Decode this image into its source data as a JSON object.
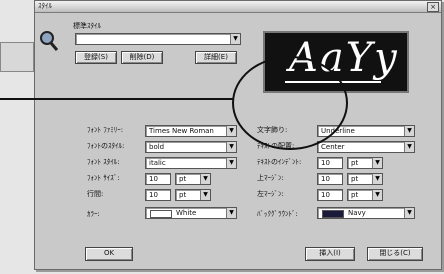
{
  "window": {
    "title": "ｽﾀｲﾙ",
    "close": "×"
  },
  "style_label": "標準ｽﾀｲﾙ",
  "style_value": "",
  "buttons": {
    "register": "登録(S)",
    "delete": "削除(D)",
    "edit": "詳細(E)",
    "ok": "OK",
    "insert": "挿入(I)",
    "close": "閉じる(C)"
  },
  "preview_text": "AaYy",
  "left_fields": [
    {
      "label": "ﾌｫﾝﾄ ﾌｧﾐﾘｰ:",
      "value": "Times New Roman"
    },
    {
      "label": "ﾌｫﾝﾄのｽﾀｲﾙ:",
      "value": "bold"
    },
    {
      "label": "ﾌｫﾝﾄ ｽﾀｲﾙ:",
      "value": "italic"
    },
    {
      "label": "ﾌｫﾝﾄ ｻｲｽﾞ:",
      "value": "10",
      "unit": "pt"
    },
    {
      "label": "行間:",
      "value": "10",
      "unit": "pt"
    },
    {
      "label": "ｶﾗｰ:",
      "value": "White",
      "swatch": "#ffffff"
    }
  ],
  "right_fields": [
    {
      "label": "文字飾り:",
      "value": "Underline"
    },
    {
      "label": "ﾃｷｽﾄの配置:",
      "value": "Center"
    },
    {
      "label": "ﾃｷｽﾄのｲﾝﾃﾞﾝﾄ:",
      "value": "10",
      "unit": "pt"
    },
    {
      "label": "上ﾏｰｼﾞﾝ:",
      "value": "10",
      "unit": "pt"
    },
    {
      "label": "左ﾏｰｼﾞﾝ:",
      "value": "10",
      "unit": "pt"
    },
    {
      "label": "ﾊﾞｯｸｸﾞﾗｳﾝﾄﾞ:",
      "value": "Navy",
      "swatch": "#1a1a3a"
    }
  ],
  "colors": {
    "preview_bg": "#111111",
    "dialog_bg": "#c9c9c9"
  }
}
